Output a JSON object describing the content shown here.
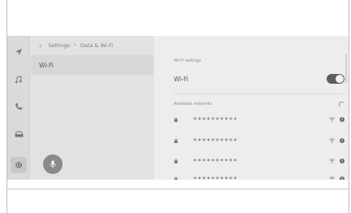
{
  "breadcrumb": {
    "back": "‹",
    "parent": "Settings",
    "separator": "•",
    "current": "Data & Wi-Fi"
  },
  "left_menu": {
    "selected": "Wi-Fi"
  },
  "rail": {
    "items": [
      "navigation-icon",
      "music-icon",
      "phone-icon",
      "car-icon",
      "settings-icon"
    ]
  },
  "wifi": {
    "section_title": "Wi-Fi settings",
    "label": "Wi-Fi",
    "enabled": true,
    "available_title": "Available networks",
    "networks": [
      {
        "ssid": "**********"
      },
      {
        "ssid": "**********"
      },
      {
        "ssid": "**********"
      },
      {
        "ssid": "**********"
      }
    ]
  },
  "colors": {
    "background": "#e7e7e7",
    "toggle_on": "#5e5e5e",
    "voice_button": "#8a8a8a"
  }
}
